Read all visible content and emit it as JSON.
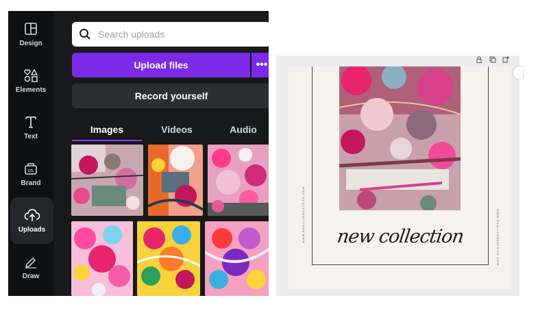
{
  "sidebar": {
    "items": [
      {
        "label": "Design",
        "icon": "layout-icon"
      },
      {
        "label": "Elements",
        "icon": "shapes-icon"
      },
      {
        "label": "Text",
        "icon": "text-icon"
      },
      {
        "label": "Brand",
        "icon": "brand-kit-icon"
      },
      {
        "label": "Uploads",
        "icon": "cloud-upload-icon",
        "active": true
      },
      {
        "label": "Draw",
        "icon": "pen-icon"
      }
    ]
  },
  "uploads": {
    "search_placeholder": "Search uploads",
    "upload_label": "Upload files",
    "more_label": "•••",
    "record_label": "Record yourself",
    "tabs": [
      {
        "label": "Images",
        "active": true
      },
      {
        "label": "Videos"
      },
      {
        "label": "Audio"
      }
    ]
  },
  "canvas": {
    "title_text": "new collection",
    "side_text_left": "WWW.REALLYGREATSITE.COM",
    "side_text_right": "WWW.REALLYGREATSITE.COM",
    "top_icons": [
      "lock-icon",
      "duplicate-icon",
      "add-page-icon"
    ]
  },
  "colors": {
    "accent": "#7d2ae8",
    "panel_bg": "#18191b",
    "rail_bg": "#0e0f11",
    "page_bg": "#f6f3ee"
  }
}
